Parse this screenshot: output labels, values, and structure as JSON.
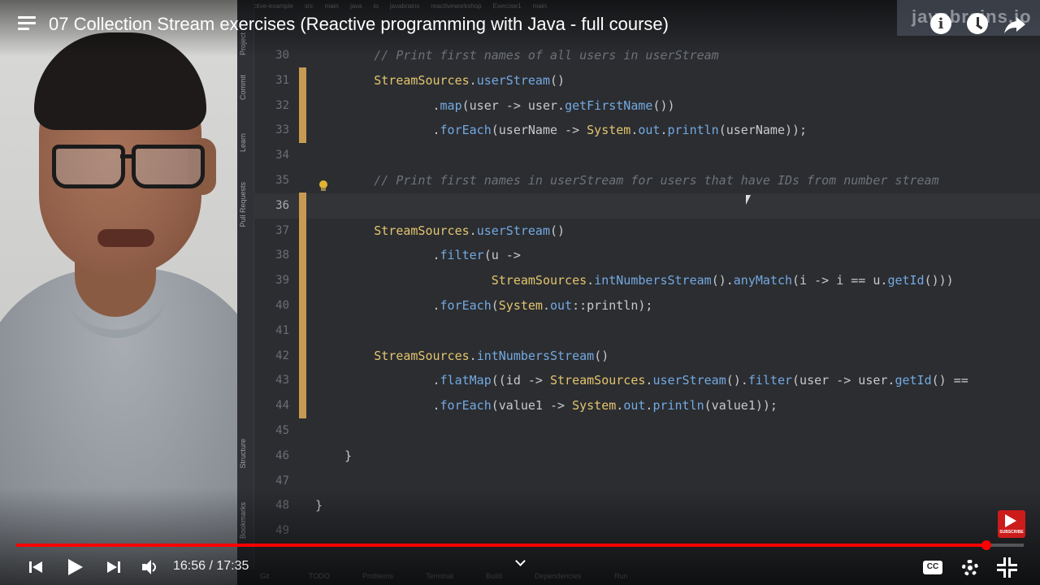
{
  "video": {
    "title": "07 Collection Stream exercises (Reactive programming with Java - full course)",
    "current_time": "16:56",
    "duration": "17:35",
    "time_display": "16:56 / 17:35",
    "progress_fraction": 0.963,
    "watermark": "javabrains.io",
    "subscribe_label": "SUBSCRIBE",
    "cc_label": "CC"
  },
  "ide": {
    "breadcrumbs": [
      "reactive-example",
      "src",
      "main",
      "java",
      "io",
      "javabrains",
      "reactiveworkshop",
      "Exercise1",
      "main"
    ],
    "tool_windows": [
      "Project",
      "Commit",
      "Learn",
      "Pull Requests",
      "Structure",
      "Bookmarks"
    ],
    "bottom_tabs": [
      "Git",
      "TODO",
      "Problems",
      "Terminal",
      "Build",
      "Dependencies",
      "Run"
    ],
    "lines": [
      {
        "n": "30",
        "text": "        // Print first names of all users in userStream"
      },
      {
        "n": "31",
        "text": "        StreamSources.userStream()"
      },
      {
        "n": "32",
        "text": "                .map(user -> user.getFirstName())"
      },
      {
        "n": "33",
        "text": "                .forEach(userName -> System.out.println(userName));"
      },
      {
        "n": "34",
        "text": ""
      },
      {
        "n": "35",
        "text": "        // Print first names in userStream for users that have IDs from number stream"
      },
      {
        "n": "36",
        "text": ""
      },
      {
        "n": "37",
        "text": "        StreamSources.userStream()"
      },
      {
        "n": "38",
        "text": "                .filter(u ->"
      },
      {
        "n": "39",
        "text": "                        StreamSources.intNumbersStream().anyMatch(i -> i == u.getId()))"
      },
      {
        "n": "40",
        "text": "                .forEach(System.out::println);"
      },
      {
        "n": "41",
        "text": ""
      },
      {
        "n": "42",
        "text": "        StreamSources.intNumbersStream()"
      },
      {
        "n": "43",
        "text": "                .flatMap((id -> StreamSources.userStream().filter(user -> user.getId() =="
      },
      {
        "n": "44",
        "text": "                .forEach(value1 -> System.out.println(value1));"
      },
      {
        "n": "45",
        "text": ""
      },
      {
        "n": "46",
        "text": "    }"
      },
      {
        "n": "47",
        "text": ""
      },
      {
        "n": "48",
        "text": "}"
      },
      {
        "n": "49",
        "text": ""
      }
    ]
  },
  "colors": {
    "progress_played": "#ff0000",
    "change_marker": "#c79a53",
    "editor_bg": "#2b2d31"
  },
  "icons": [
    "menu-icon",
    "info-icon",
    "clock-icon",
    "share-icon",
    "prev-icon",
    "play-icon",
    "next-icon",
    "volume-icon",
    "chevron-down-icon",
    "cc-icon",
    "gear-icon",
    "exit-fullscreen-icon",
    "lightbulb-icon"
  ]
}
